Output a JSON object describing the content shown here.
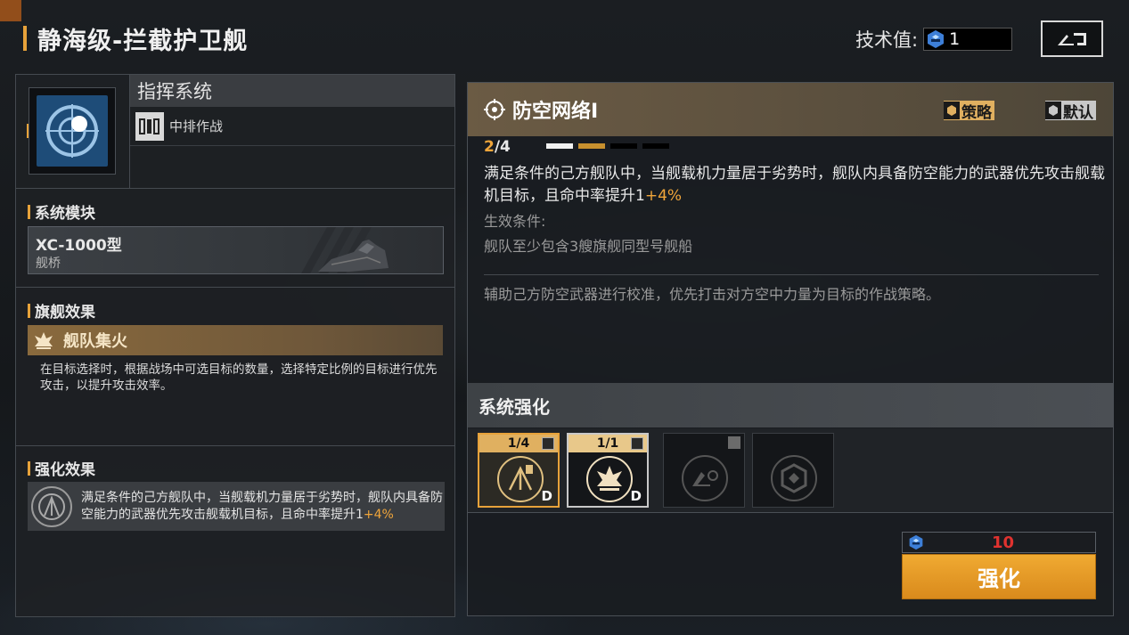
{
  "header": {
    "title": "静海级-拦截护卫舰",
    "tech_label": "技术值:",
    "tech_value": "1"
  },
  "command": {
    "title": "指挥系统",
    "sub": "中排作战"
  },
  "module": {
    "section": "系统模块",
    "name": "XC-1000型",
    "type": "舰桥"
  },
  "flagship": {
    "section": "旗舰效果",
    "name": "舰队集火",
    "desc": "在目标选择时，根据战场中可选目标的数量，选择特定比例的目标进行优先攻击，以提升攻击效率。"
  },
  "enhance_effect": {
    "section": "强化效果",
    "text": "满足条件的己方舰队中，当舰载机力量居于劣势时，舰队内具备防空能力的武器优先攻击舰载机目标，且命中率提升1",
    "bonus": "+4%"
  },
  "strategy": {
    "title": "防空网络Ⅰ",
    "tag_strategy": "策略",
    "tag_default": "默认",
    "level_cur": "2",
    "level_max": "/4",
    "level_value": 2,
    "level_total": 4,
    "desc": "满足条件的己方舰队中，当舰载机力量居于劣势时，舰队内具备防空能力的武器优先攻击舰载机目标，且命中率提升1",
    "desc_bonus": "+4%",
    "cond_label": "生效条件:",
    "cond_text": "舰队至少包含3艘旗舰同型号舰船",
    "flavor": "辅助己方防空武器进行校准，优先打击对方空中力量为目标的作战策略。"
  },
  "system_enhance": {
    "title": "系统强化",
    "slots": [
      {
        "level": "1/4",
        "mark": "D"
      },
      {
        "level": "1/1",
        "mark": "D"
      }
    ],
    "cost": "10",
    "button": "强化"
  },
  "colors": {
    "accent": "#e7a23a",
    "bonus": "#f0a53a",
    "cost": "#e0322f"
  }
}
